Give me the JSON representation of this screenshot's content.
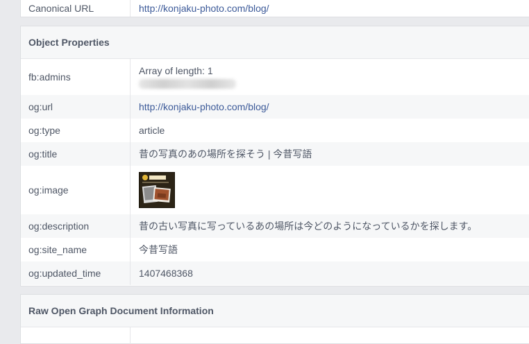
{
  "top_row": {
    "key": "Canonical URL",
    "value": "http://konjaku-photo.com/blog/"
  },
  "object_properties": {
    "title": "Object Properties",
    "rows": [
      {
        "key": "fb:admins",
        "value": "Array of length: 1"
      },
      {
        "key": "og:url",
        "value": "http://konjaku-photo.com/blog/"
      },
      {
        "key": "og:type",
        "value": "article"
      },
      {
        "key": "og:title",
        "value": "昔の写真のあの場所を探そう | 今昔写語"
      },
      {
        "key": "og:image",
        "value": ""
      },
      {
        "key": "og:description",
        "value": "昔の古い写真に写っているあの場所は今どのようになっているかを探します。"
      },
      {
        "key": "og:site_name",
        "value": "今昔写語"
      },
      {
        "key": "og:updated_time",
        "value": "1407468368"
      }
    ]
  },
  "raw_section": {
    "title": "Raw Open Graph Document Information"
  },
  "colors": {
    "link": "#3b5998",
    "text": "#4e5665",
    "background": "#e9eaed"
  }
}
